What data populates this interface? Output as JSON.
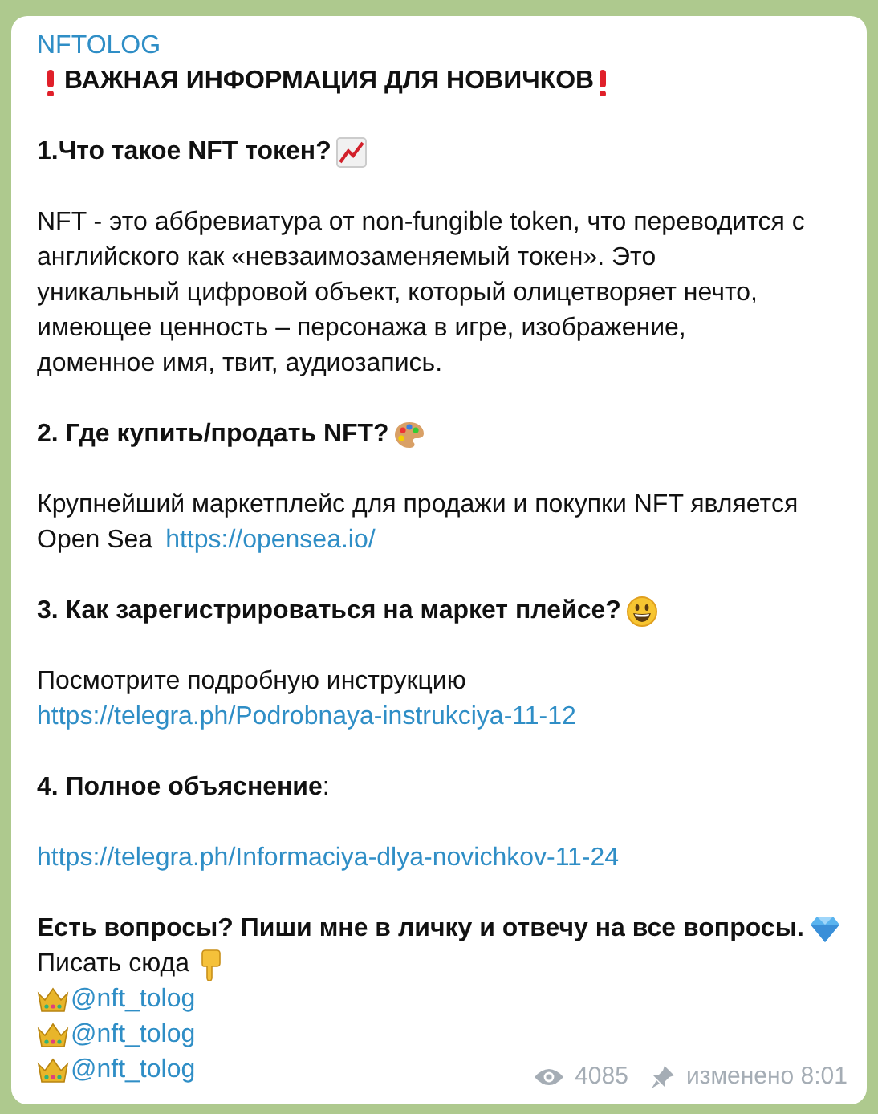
{
  "channel": {
    "name": "NFTOLOG"
  },
  "sections": [
    [
      {
        "kind": "title",
        "text": "ВАЖНАЯ ИНФОРМАЦИЯ ДЛЯ НОВИЧКОВ"
      }
    ],
    [
      {
        "kind": "heading",
        "text": "1.Что такое NFT токен?"
      }
    ],
    [
      {
        "kind": "text",
        "lines": [
          "NFT - это аббревиатура от non-fungible token, что переводится с",
          "английского как «невзаимозаменяемый токен». Это",
          "уникальный цифровой объект, который олицетворяет нечто,",
          "имеющее ценность – персонажа в игре, изображение,",
          "доменное имя, твит, аудиозапись."
        ]
      }
    ],
    [
      {
        "kind": "heading",
        "text": "2. Где купить/продать NFT?"
      }
    ],
    [
      {
        "kind": "text",
        "lines": [
          "Крупнейший маркетплейс для продажи и покупки NFT является",
          "Open Sea"
        ],
        "link": "https://opensea.io/"
      }
    ],
    [
      {
        "kind": "heading",
        "text": "3. Как зарегистрироваться на маркет плейсе?"
      }
    ],
    [
      {
        "kind": "text",
        "lines": [
          "Посмотрите подробную инструкцию"
        ]
      },
      {
        "kind": "link",
        "text": "https://telegra.ph/Podrobnaya-instrukciya-11-12"
      }
    ],
    [
      {
        "kind": "text",
        "lines": [
          "**4. Полное объяснение**:"
        ]
      }
    ],
    [
      {
        "kind": "link",
        "text": "https://telegra.ph/Informaciya-dlya-novichkov-11-24"
      }
    ],
    [
      {
        "kind": "heading",
        "text": "Есть вопросы? Пиши мне в личку и отвечу на все вопросы."
      },
      {
        "kind": "text",
        "lines": [
          "Писать сюда"
        ]
      },
      {
        "kind": "mention",
        "text": "@nft_tolog"
      },
      {
        "kind": "mention",
        "text": "@nft_tolog"
      },
      {
        "kind": "mention",
        "text": "@nft_tolog"
      }
    ]
  ],
  "footer": {
    "views": "4085",
    "edited": "изменено 8:01"
  }
}
